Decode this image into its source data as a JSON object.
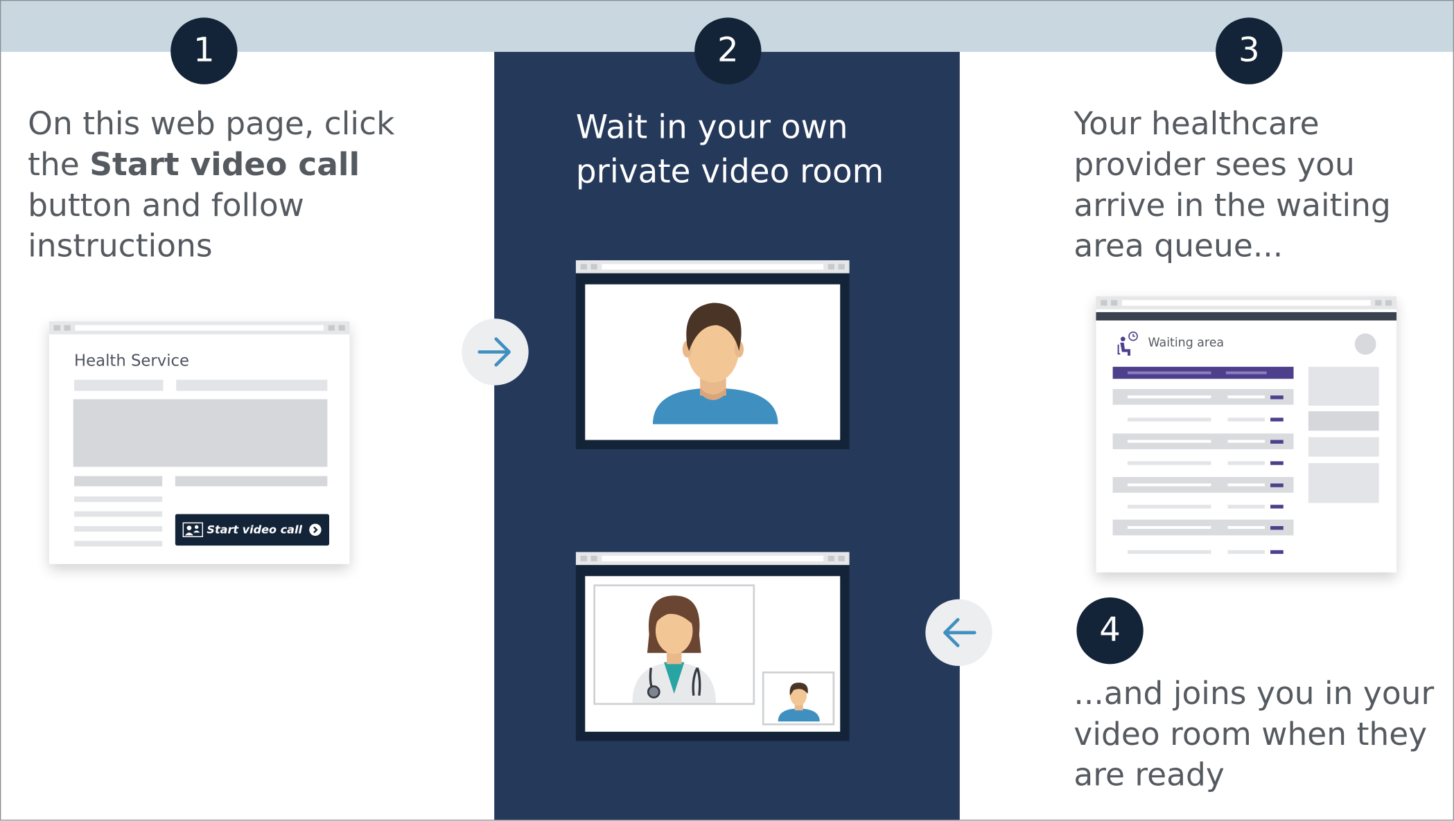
{
  "steps": [
    {
      "number": "1",
      "text_pre": "On this web page, click the ",
      "text_bold": "Start video call",
      "text_post": " button and follow instructions"
    },
    {
      "number": "2",
      "text": "Wait in your own private video room"
    },
    {
      "number": "3",
      "text": "Your healthcare provider sees you arrive in the waiting area queue..."
    },
    {
      "number": "4",
      "text": "...and joins you in your video room when they are ready"
    }
  ],
  "website_mockup": {
    "title": "Health Service",
    "button_label": "Start video call"
  },
  "waiting_area_mockup": {
    "title": "Waiting area"
  },
  "icons": {
    "arrow_right": "arrow-right-icon",
    "arrow_left": "arrow-left-icon",
    "patient": "person-avatar-icon",
    "doctor": "doctor-avatar-icon",
    "video_call": "video-call-icon",
    "chevron": "chevron-right-circle-icon",
    "waiting": "waiting-room-icon"
  },
  "colors": {
    "navy_panel": "#25395a",
    "badge": "#142438",
    "top_band": "#c9d8e0",
    "accent_blue": "#3f8fc0",
    "purple": "#4d3f8c",
    "body_text": "#555a60"
  }
}
